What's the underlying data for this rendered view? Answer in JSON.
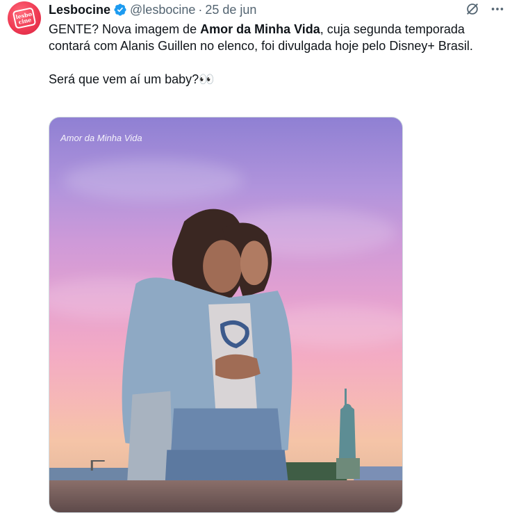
{
  "tweet": {
    "author_name": "Lesbocine",
    "handle": "@lesbocine",
    "separator": "·",
    "date": "25 de jun",
    "avatar_text_line1": "lesbo",
    "avatar_text_line2": "cine",
    "text_part1": "GENTE? Nova imagem de ",
    "text_bold": "Amor da Minha Vida",
    "text_part2": ", cuja segunda temporada contará com Alanis Guillen no elenco, foi divulgada hoje pelo Disney+ Brasil.",
    "text_line2": "Será que vem aí um baby?👀",
    "media_watermark": "Amor da Minha Vida"
  },
  "colors": {
    "accent_verified": "#1d9bf0",
    "secondary_text": "#536471",
    "avatar_red": "#ef3b54"
  },
  "icons": [
    "verified-badge-icon",
    "grok-icon",
    "more-icon"
  ]
}
